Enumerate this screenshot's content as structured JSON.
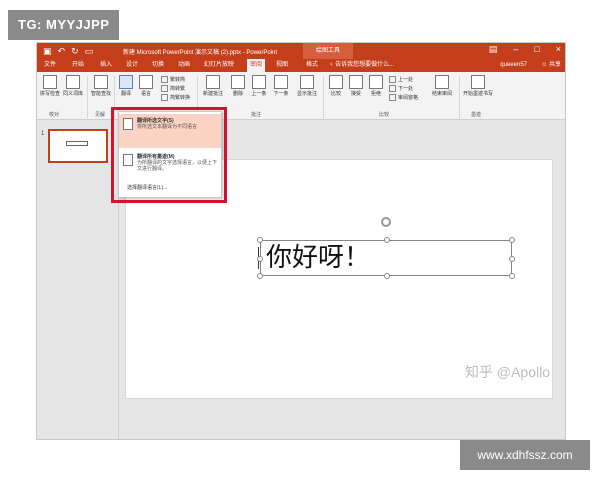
{
  "badges": {
    "top": "TG: MYYJJPP",
    "bottom": "www.xdhfssz.com"
  },
  "titlebar": {
    "doc_title": "新建 Microsoft PowerPoint 演示文稿 (2).pptx - PowerPoint",
    "context_tab": "绘图工具",
    "minimize": "–",
    "restore": "□",
    "close": "×"
  },
  "tabs": {
    "items": [
      "文件",
      "开始",
      "插入",
      "设计",
      "切换",
      "动画",
      "幻灯片放映",
      "审阅",
      "视图",
      "格式"
    ],
    "active_index": 7,
    "search": "告诉我您想要做什么...",
    "user": "queeen57",
    "share": "共享"
  },
  "ribbon": {
    "buttons": [
      {
        "label": "拼写检查"
      },
      {
        "label": "同义词库"
      },
      {
        "label": "智能查找"
      },
      {
        "label": "翻译"
      },
      {
        "label": "语言"
      },
      {
        "label": "新建批注"
      },
      {
        "label": "删除"
      },
      {
        "label": "上一条"
      },
      {
        "label": "下一条"
      },
      {
        "label": "显示批注"
      },
      {
        "label": "比较"
      },
      {
        "label": "接受"
      },
      {
        "label": "拒绝"
      },
      {
        "label": "结束审阅"
      },
      {
        "label": "开始墨迹书写"
      }
    ],
    "small_items": [
      "繁转简",
      "简转繁",
      "简繁转换",
      "上一处",
      "下一处",
      "审阅窗格"
    ],
    "groups": [
      "校对",
      "见解",
      "批注",
      "比较",
      "墨迹"
    ]
  },
  "menu": {
    "items": [
      {
        "title": "翻译所选文字(S)",
        "desc": "将所选文本翻译为不同语言"
      },
      {
        "title": "翻译所有墨迹(M)",
        "desc": "为所翻译的文字选择语言，以便上下文进行翻译。"
      }
    ],
    "bottom": "选择翻译语言(L)..."
  },
  "thumbnail": {
    "number": "1"
  },
  "slide": {
    "text": "你好呀！",
    "watermark": "知乎 @Apollo"
  }
}
